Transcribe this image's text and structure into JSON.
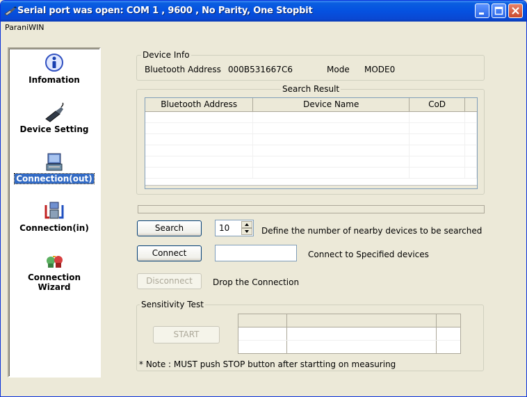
{
  "window": {
    "title": "Serial port was open: COM 1 , 9600 , No Parity, One Stopbit",
    "app_menu_label": "ParaniWIN"
  },
  "sidebar": {
    "items": [
      {
        "label": "Infomation",
        "icon": "info-icon",
        "selected": false
      },
      {
        "label": "Device Setting",
        "icon": "serial-device-icon",
        "selected": false
      },
      {
        "label": "Connection(out)",
        "icon": "computer-outgoing-icon",
        "selected": true
      },
      {
        "label": "Connection(in)",
        "icon": "computer-incoming-icon",
        "selected": false
      },
      {
        "label": "Connection Wizard",
        "icon": "wizard-icon",
        "selected": false
      }
    ]
  },
  "device_info": {
    "legend": "Device Info",
    "address_label": "Bluetooth Address",
    "address_value": "000B531667C6",
    "mode_label": "Mode",
    "mode_value": "MODE0"
  },
  "search_result": {
    "legend": "Search Result",
    "columns": [
      "Bluetooth Address",
      "Device Name",
      "CoD"
    ],
    "rows": [
      [
        "",
        "",
        ""
      ],
      [
        "",
        "",
        ""
      ],
      [
        "",
        "",
        ""
      ],
      [
        "",
        "",
        ""
      ],
      [
        "",
        "",
        ""
      ],
      [
        "",
        "",
        ""
      ]
    ]
  },
  "controls": {
    "search_label": "Search",
    "search_count": "10",
    "search_hint": "Define the number of nearby devices to be searched",
    "connect_label": "Connect",
    "connect_value": "",
    "connect_hint": "Connect to Specified devices",
    "disconnect_label": "Disconnect",
    "disconnect_hint": "Drop the Connection"
  },
  "sensitivity": {
    "legend": "Sensitivity Test",
    "start_label": "START",
    "note": "* Note : MUST push STOP button after startting on measuring"
  },
  "colors": {
    "title_bar": "#0551e0",
    "selection": "#316ac5",
    "window_bg": "#ece9d8"
  }
}
